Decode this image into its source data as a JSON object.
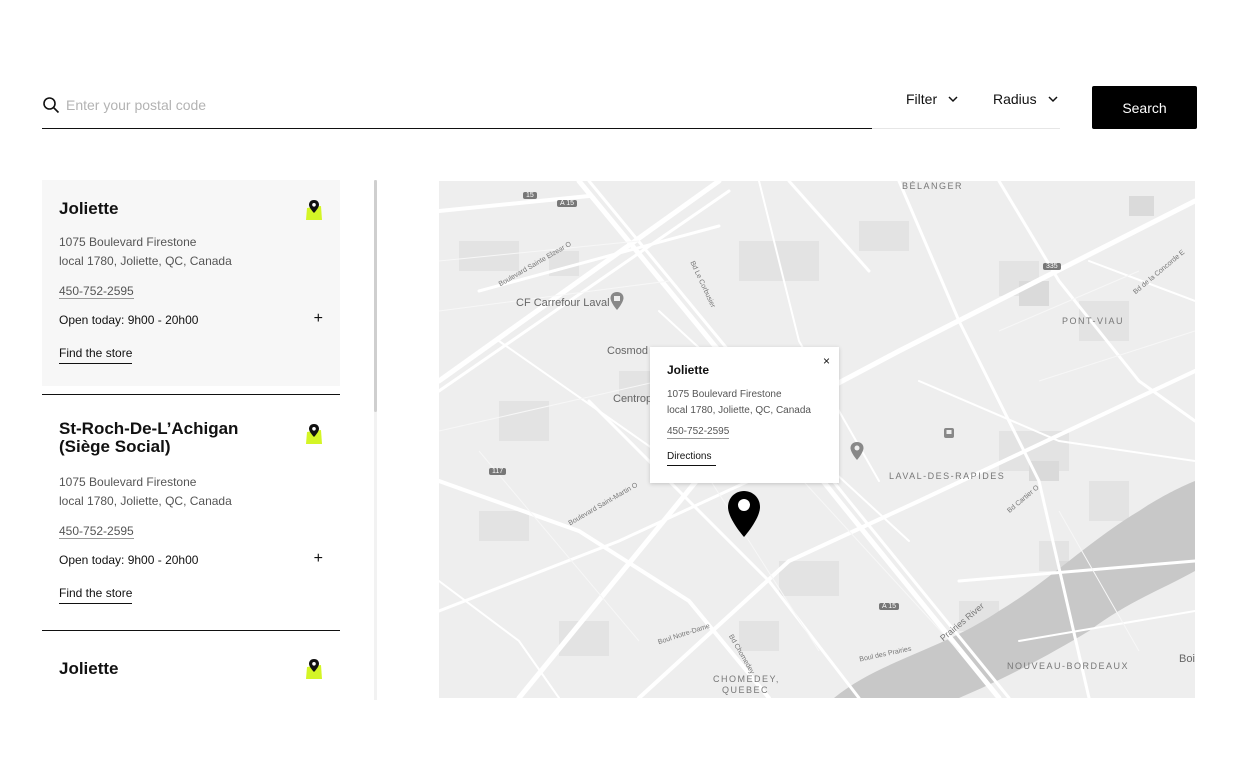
{
  "search": {
    "placeholder": "Enter your postal code",
    "value": "",
    "filter_label": "Filter",
    "radius_label": "Radius",
    "button_label": "Search"
  },
  "stores": [
    {
      "name": "Joliette",
      "address_line1": "1075 Boulevard Firestone",
      "address_line2": "local 1780, Joliette, QC, Canada",
      "phone": "450-752-2595",
      "hours": "Open today: 9h00 - 20h00",
      "find_label": "Find the store"
    },
    {
      "name": "St-Roch-De-L’Achigan (Siège Social)",
      "address_line1": "1075 Boulevard Firestone",
      "address_line2": "local 1780, Joliette, QC, Canada",
      "phone": "450-752-2595",
      "hours": "Open today: 9h00 - 20h00",
      "find_label": "Find the store"
    },
    {
      "name": "Joliette"
    }
  ],
  "popup": {
    "title": "Joliette",
    "address_line1": "1075 Boulevard Firestone",
    "address_line2": "local 1780, Joliette, QC, Canada",
    "phone": "450-752-2595",
    "directions_label": "Directions",
    "close_glyph": "×"
  },
  "map_labels": {
    "belanger": "BÉLANGER",
    "pont_viau": "PONT-VIAU",
    "laval_des_rapides": "LAVAL-DES-RAPIDES",
    "chomedey": "CHOMEDEY,",
    "quebec": "QUEBEC",
    "nouveau_bordeaux": "NOUVEAU-BORDEAUX",
    "cf_carrefour": "CF Carrefour Laval",
    "cosmodome": "Cosmod",
    "centropolis": "Centrop",
    "boi": "Boi",
    "prairies_river": "Prairies River",
    "a15_top": "A 15",
    "r15": "15",
    "r117": "117",
    "a15_bottom": "A 15",
    "r335": "335",
    "blvd_saint_martin": "Boulevard Saint-Martin O",
    "blvd_des_prairies": "Boul des Prairies",
    "blvd_notre_dame": "Boul Notre-Dame",
    "bd_chomedey": "Bd Chomedey",
    "bd_le_corbusier": "Bd Le Corbusier",
    "blvd_concorde": "Bd de la Concorde E",
    "bd_cartier": "Bd Cartier O",
    "blvd_sainte_elzear": "Boulevard Sainte Elzear O"
  },
  "colors": {
    "accent": "#d4f526",
    "map_background": "#eeeeee",
    "map_road": "#ffffff",
    "map_water": "#c8c8c8",
    "button_bg": "#000000"
  }
}
